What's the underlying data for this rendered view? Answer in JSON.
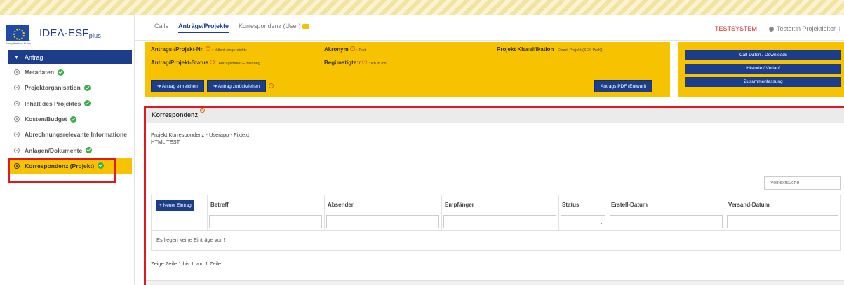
{
  "app": {
    "brand": "IDEA-ESF",
    "brand_suffix": "plus",
    "eu_caption": "Kofinanziert von der Europäischen Union"
  },
  "sidebar": {
    "header": "Antrag",
    "items": [
      {
        "label": "Metadaten",
        "done": true
      },
      {
        "label": "Projektorganisation",
        "done": true
      },
      {
        "label": "Inhalt des Projektes",
        "done": true
      },
      {
        "label": "Kosten/Budget",
        "done": true
      },
      {
        "label": "Abrechnungsrelevante Informatione",
        "done": false
      },
      {
        "label": "Anlagen/Dokumente",
        "done": true
      },
      {
        "label": "Korrespondenz (Projekt)",
        "done": true,
        "active": true
      }
    ]
  },
  "topbar": {
    "tabs": [
      "Calls",
      "Anträge/Projekte",
      "Korrespondenz (User)"
    ],
    "active_tab": 1,
    "system_label": "TESTSYSTEM",
    "user_label": "Tester:in Projektleiter_i"
  },
  "project_header": {
    "nr_label": "Antrags-/Projekt-Nr.",
    "nr_value": ": «Nicht eingereicht»",
    "status_label": "Antrag/Projekt-Status",
    "status_value": ": Antragsdaten-Erfassung",
    "acronym_label": "Akronym",
    "acronym_value": ": Test",
    "beneficiary_label": "Begünstigte:r",
    "beneficiary_value": ": Ich in Ich",
    "classification_label": "Projekt Klassifikation",
    "classification_value": ": Einzel-Projekt (SEK ProK)",
    "submit_button": "Antrag einreichen",
    "withdraw_button": "Antrag zurückziehen",
    "pdf_button": "Antrags PDF (Entwurf)"
  },
  "right_panel": {
    "buttons": [
      "Call-Daten / Downloads",
      "Historie / Verlauf",
      "Zusammenfassung"
    ]
  },
  "korrespondenz": {
    "title": "Korrespondenz",
    "text_line1": "Projekt Korrespondenz - Userapp - Fixtext",
    "text_line2": "HTML TEST",
    "search_placeholder": "Volltextsuche",
    "new_entry_button": "Neuer Eintrag",
    "columns": [
      "Betreff",
      "Absender",
      "Empfänger",
      "Status",
      "Erstell-Datum",
      "Versand-Datum"
    ],
    "empty_message": "Es liegen keine Einträge vor !",
    "pagination": "Zeige Zeile 1 bis 1 von 1 Zeile."
  },
  "colors": {
    "accent_yellow": "#f7c300",
    "primary_blue": "#1c3d8a",
    "highlight_red": "#e0191e",
    "success_green": "#3cae45"
  }
}
